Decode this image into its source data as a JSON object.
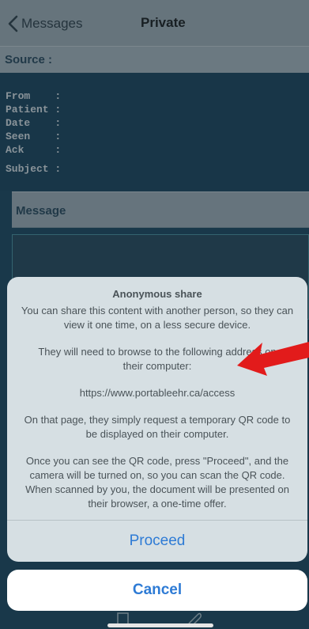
{
  "nav": {
    "back_label": "Messages",
    "title": "Private"
  },
  "source": {
    "label": "Source :",
    "fields": [
      "From    :",
      "Patient :",
      "Date    :",
      "Seen    :",
      "Ack     :",
      "Subject :"
    ]
  },
  "message": {
    "label": "Message"
  },
  "sheet": {
    "title": "Anonymous share",
    "p1_line1": "You can share this content with another person, so they can",
    "p1_line2": "view it one time, on a less secure device.",
    "p2_line1": "They will need to browse to the following address on",
    "p2_line2": "their computer:",
    "url": "https://www.portableehr.ca/access",
    "p3_line1": "On that page, they simply request a temporary QR code to",
    "p3_line2": "be displayed on their computer.",
    "p4_line1": "Once you can see the QR code, press \"Proceed\", and the",
    "p4_line2": "camera will be turned on, so you can scan the QR code.",
    "p4_line3": "When scanned by you, the document will be presented on",
    "p4_line4": "their browser, a one-time offer.",
    "proceed_label": "Proceed",
    "cancel_label": "Cancel"
  },
  "colors": {
    "accent": "#2e7bd5",
    "annotation_arrow": "#e21b1b"
  }
}
